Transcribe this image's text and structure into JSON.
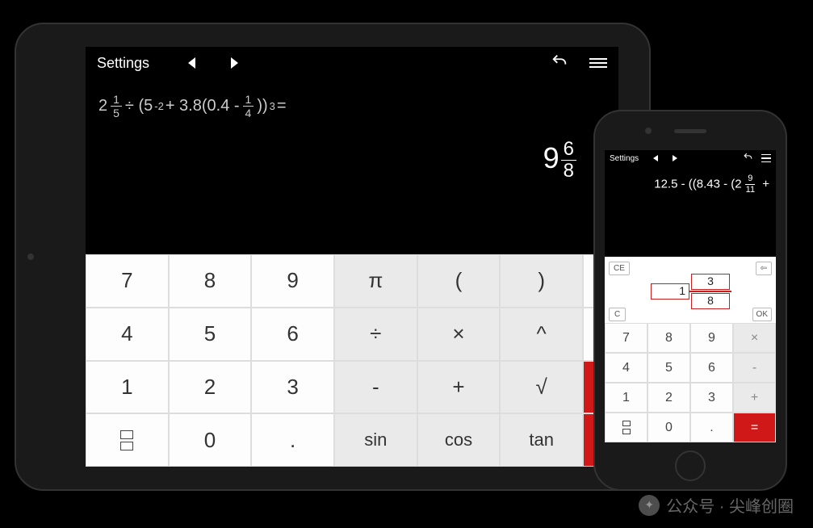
{
  "ipad": {
    "topbar": {
      "settings": "Settings"
    },
    "expression": {
      "whole1": "2",
      "frac1_num": "1",
      "frac1_den": "5",
      "mid1": " ÷ (5",
      "sup1": "-2",
      "mid2": " + 3.8(0.4 - ",
      "frac2_num": "1",
      "frac2_den": "4",
      "mid3": "))",
      "sup2": "3",
      "tail": " ="
    },
    "result": {
      "whole": "9",
      "num": "6",
      "den": "8"
    },
    "keys": {
      "k7": "7",
      "k8": "8",
      "k9": "9",
      "pi": "π",
      "lp": "(",
      "rp": ")",
      "k4": "4",
      "k5": "5",
      "k6": "6",
      "div": "÷",
      "mul": "×",
      "pow": "^",
      "k1": "1",
      "k2": "2",
      "k3": "3",
      "sub": "-",
      "add": "+",
      "sqrt": "√",
      "k0": "0",
      "dot": ".",
      "sin": "sin",
      "cos": "cos",
      "tan": "tan"
    }
  },
  "iphone": {
    "topbar": {
      "settings": "Settings"
    },
    "expression": {
      "lead": "12.5 - ((8.43 - (2",
      "num": "9",
      "den": "11",
      "tail": " +"
    },
    "input": {
      "ce": "CE",
      "c": "C",
      "ok": "OK",
      "backspace": "⇦",
      "whole": "1",
      "num": "3",
      "den": "8"
    },
    "keys": {
      "k7": "7",
      "k8": "8",
      "k9": "9",
      "mul": "×",
      "k4": "4",
      "k5": "5",
      "k6": "6",
      "sub": "-",
      "k1": "1",
      "k2": "2",
      "k3": "3",
      "add": "+",
      "k0": "0",
      "dot": ".",
      "eq": "="
    }
  },
  "watermark": "公众号 · 尖峰创圈"
}
